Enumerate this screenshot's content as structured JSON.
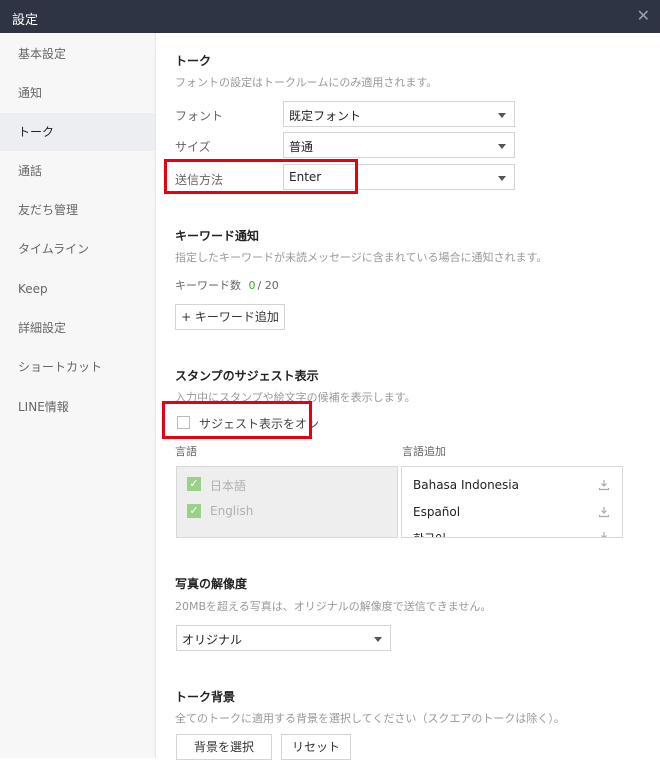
{
  "window": {
    "title": "設定"
  },
  "sidebar": {
    "items": [
      {
        "label": "基本設定"
      },
      {
        "label": "通知"
      },
      {
        "label": "トーク"
      },
      {
        "label": "通話"
      },
      {
        "label": "友だち管理"
      },
      {
        "label": "タイムライン"
      },
      {
        "label": "Keep"
      },
      {
        "label": "詳細設定"
      },
      {
        "label": "ショートカット"
      },
      {
        "label": "LINE情報"
      }
    ],
    "active_index": 2
  },
  "talk": {
    "heading": "トーク",
    "description": "フォントの設定はトークルームにのみ適用されます。",
    "font_label": "フォント",
    "font_value": "既定フォント",
    "size_label": "サイズ",
    "size_value": "普通",
    "send_label": "送信方法",
    "send_value": "Enter"
  },
  "keyword": {
    "heading": "キーワード通知",
    "description": "指定したキーワードが未読メッセージに含まれている場合に通知されます。",
    "count_label": "キーワード数",
    "count_value": "0",
    "count_max": "/ 20",
    "add_button": "+ キーワード追加"
  },
  "sticker": {
    "heading": "スタンプのサジェスト表示",
    "description": "入力中にスタンプや絵文字の候補を表示します。",
    "toggle_label": "サジェスト表示をオン",
    "checked": false,
    "languages_label": "言語",
    "add_languages_label": "言語追加",
    "languages": [
      {
        "name": "日本語"
      },
      {
        "name": "English"
      }
    ],
    "available": [
      {
        "name": "Bahasa Indonesia"
      },
      {
        "name": "Español"
      },
      {
        "name": "한국어"
      }
    ]
  },
  "photo": {
    "heading": "写真の解像度",
    "description": "20MBを超える写真は、オリジナルの解像度で送信できません。",
    "value": "オリジナル"
  },
  "background": {
    "heading": "トーク背景",
    "description": "全てのトークに適用する背景を選択してください（スクエアのトークは除く）。",
    "select_button": "背景を選択",
    "reset_button": "リセット"
  },
  "colors": {
    "highlight": "#e60012",
    "titlebar": "#2e3444",
    "count_green": "#3aa52f",
    "check_green": "#9bd08a"
  },
  "icons": {
    "close": "close-icon",
    "download": "download-icon",
    "check": "check-icon"
  }
}
